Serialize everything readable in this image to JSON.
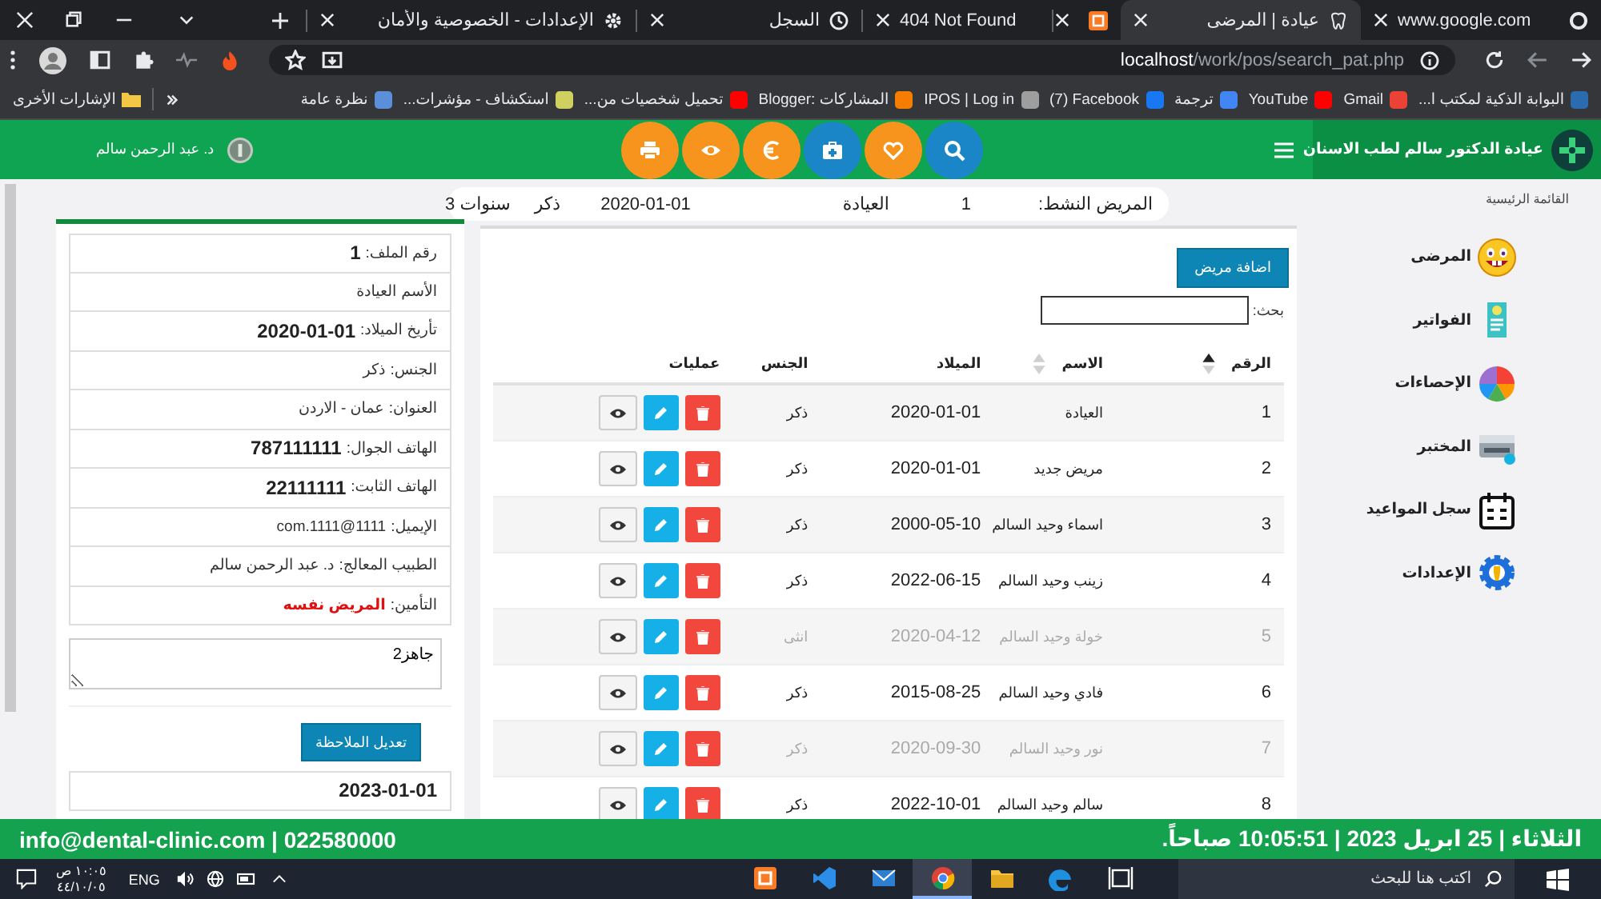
{
  "browser": {
    "tabs": [
      {
        "label": "www.google.com",
        "selected": false
      },
      {
        "label": "عيادة | المرضى",
        "selected": true
      },
      {
        "selected": false
      },
      {
        "label": "404 Not Found",
        "selected": false
      },
      {
        "label": "السجل",
        "selected": false
      },
      {
        "label": "الإعدادات - الخصوصية والأمان",
        "selected": false
      }
    ],
    "address": "**localhost**/work/pos/search_pat.php",
    "bookmarks": [
      "البوابة الذكية لمكتب ا...",
      "Gmail",
      "YouTube",
      "ترجمة",
      "(7) Facebook",
      "IPOS | Log in",
      "المشاركات :Blogger",
      "تحميل شخصيات من...",
      "استكشاف - مؤشرات...",
      "نظرة عامة"
    ],
    "other_bookmarks": "الإشارات الأخرى"
  },
  "header": {
    "title": "عيادة الدكتور سالم لطب الاسنان",
    "user": "د. عبد الرحمن سالم",
    "actions": [
      {
        "color": "#1a86c8"
      },
      {
        "color": "#f7941d"
      },
      {
        "color": "#1a86c8"
      },
      {
        "color": "#f7941d"
      },
      {
        "color": "#f7941d"
      },
      {
        "color": "#f7941d"
      }
    ]
  },
  "sidebar": {
    "title": "القائمة الرئيسية",
    "items": [
      "المرضى",
      "الفواتير",
      "الإحصاءات",
      "المختبر",
      "سجل المواعيد",
      "الإعدادات"
    ]
  },
  "active_patient": {
    "label": "المريض النشط:",
    "fields": [
      "1",
      "العيادة",
      "2020-01-01",
      "ذكر",
      "3 سنوات"
    ]
  },
  "patients": {
    "add_button": "اضافة مريض",
    "search_label": "بحث:",
    "columns": [
      {
        "label": "الرقم",
        "sortable": true,
        "sorted": true
      },
      {
        "label": "الاسم",
        "sortable": true,
        "sorted": false
      },
      {
        "label": "الميلاد"
      },
      {
        "label": "الجنس"
      },
      {
        "label": "عمليات"
      }
    ],
    "rows": [
      {
        "cells": [
          "1",
          "العيادة",
          "2020-01-01",
          "ذكر"
        ],
        "dimmed": false
      },
      {
        "cells": [
          "2",
          "مريض جديد",
          "2020-01-01",
          "ذكر"
        ],
        "dimmed": false
      },
      {
        "cells": [
          "3",
          "اسماء وحيد السالم",
          "2000-05-10",
          "ذكر"
        ],
        "dimmed": false
      },
      {
        "cells": [
          "4",
          "زينب وحيد السالم",
          "2022-06-15",
          "ذكر"
        ],
        "dimmed": false
      },
      {
        "cells": [
          "5",
          "خولة وحيد السالم",
          "2020-04-12",
          "انثى"
        ],
        "dimmed": true
      },
      {
        "cells": [
          "6",
          "فادي وحيد السالم",
          "2015-08-25",
          "ذكر"
        ],
        "dimmed": false
      },
      {
        "cells": [
          "7",
          "نور وحيد السالم",
          "2020-09-30",
          "ذكر"
        ],
        "dimmed": true
      },
      {
        "cells": [
          "8",
          "سالم وحيد السالم",
          "2022-10-01",
          "ذكر"
        ],
        "dimmed": false
      }
    ]
  },
  "patient_card": {
    "rows": [
      {
        "label": "رقم الملف:",
        "value": "1",
        "kind": "bold"
      },
      {
        "label": "الأسم",
        "value": "العيادة",
        "kind": "plain"
      },
      {
        "label": "تأريخ الميلاد:",
        "value": "2020-01-01",
        "kind": "bold"
      },
      {
        "label": "الجنس:",
        "value": "ذكر",
        "kind": "plain"
      },
      {
        "label": "العنوان:",
        "value": "عمان - الاردن",
        "kind": "plain"
      },
      {
        "label": "الهاتف الجوال:",
        "value": "787111111",
        "kind": "bold"
      },
      {
        "label": "الهاتف الثابت:",
        "value": "22111111",
        "kind": "bold"
      },
      {
        "label": "الإيميل:",
        "value": "1111@1111.com",
        "kind": "plain"
      },
      {
        "label": "الطبيب المعالج:",
        "value": "د. عبد الرحمن سالم",
        "kind": "plain"
      },
      {
        "label": "التأمين:",
        "value": "المريض نفسه",
        "kind": "alert"
      }
    ],
    "notes": "جاهز2",
    "save_button": "تعديل الملاحظة",
    "next_row_value": "2023-01-01"
  },
  "footer": {
    "contact": "info@dental-clinic.com | 022580000",
    "datetime": "الثلاثاء | 25 ابريل 2023 | 10:05:51 صباحاً."
  },
  "taskbar": {
    "search_placeholder": "اكتب هنا للبحث",
    "apps": [
      {
        "selected": false
      },
      {
        "selected": false
      },
      {
        "selected": false
      },
      {
        "selected": true
      },
      {
        "selected": false
      },
      {
        "selected": false
      },
      {
        "selected": false
      }
    ],
    "language": "ENG",
    "time": "١٠:٠٥ ص",
    "date": "٤٤/١٠/٠٥"
  }
}
